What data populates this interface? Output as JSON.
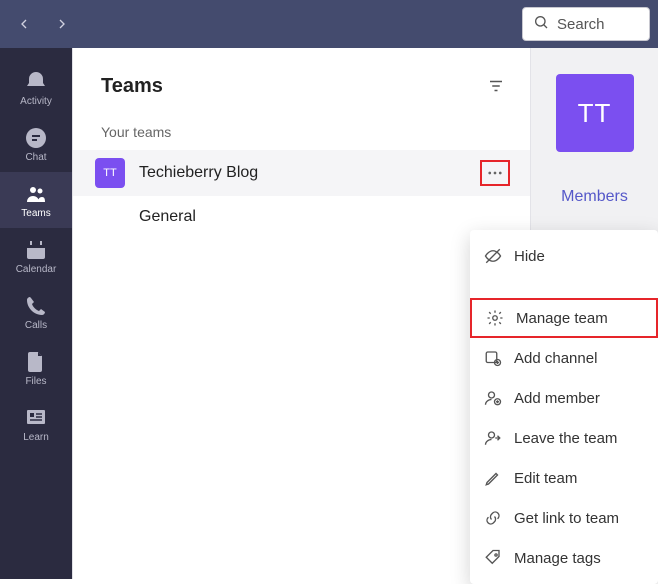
{
  "titlebar": {
    "search_placeholder": "Search"
  },
  "rail": {
    "items": [
      {
        "label": "Activity"
      },
      {
        "label": "Chat"
      },
      {
        "label": "Teams"
      },
      {
        "label": "Calendar"
      },
      {
        "label": "Calls"
      },
      {
        "label": "Files"
      },
      {
        "label": "Learn"
      }
    ]
  },
  "teams": {
    "title": "Teams",
    "section_label": "Your teams",
    "team_avatar_initials": "TT",
    "team_name": "Techieberry Blog",
    "channel_name": "General"
  },
  "right_panel": {
    "avatar_initials": "TT",
    "members_label": "Members"
  },
  "context_menu": {
    "hide": "Hide",
    "manage_team": "Manage team",
    "add_channel": "Add channel",
    "add_member": "Add member",
    "leave_team": "Leave the team",
    "edit_team": "Edit team",
    "get_link": "Get link to team",
    "manage_tags": "Manage tags"
  }
}
